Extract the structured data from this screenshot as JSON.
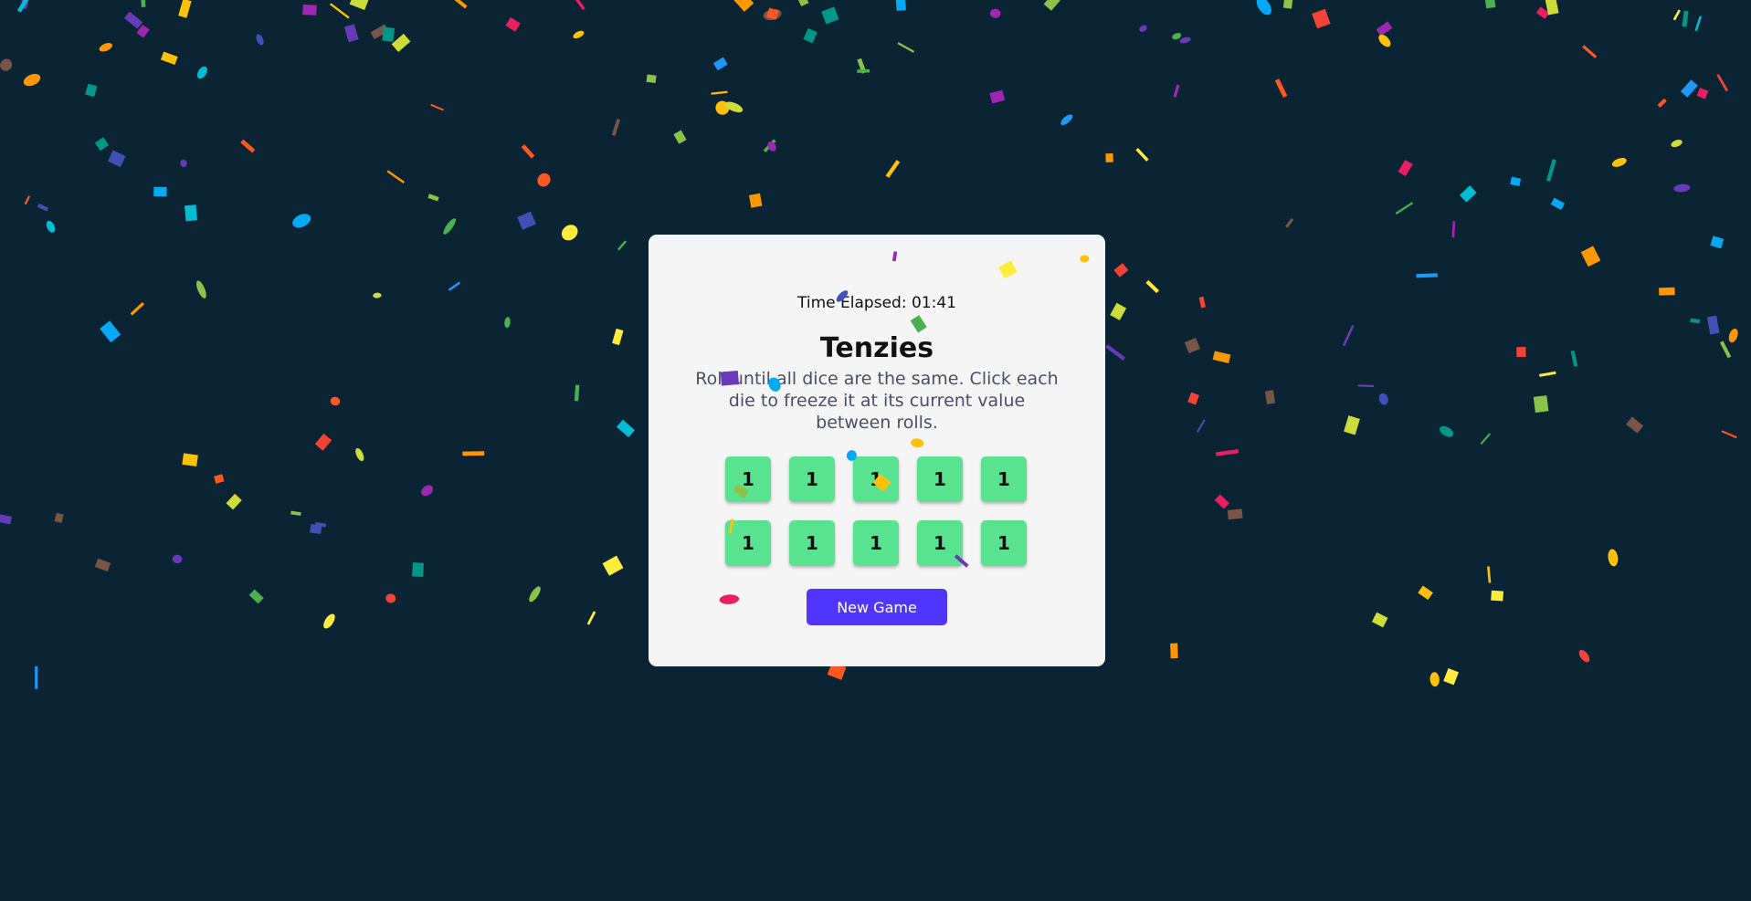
{
  "timer": {
    "label": "Time Elapsed:",
    "value": "01:41"
  },
  "title": "Tenzies",
  "instructions": "Roll until all dice are the same. Click each die to freeze it at its current value between rolls.",
  "dice": [
    "1",
    "1",
    "1",
    "1",
    "1",
    "1",
    "1",
    "1",
    "1",
    "1"
  ],
  "new_game_label": "New Game",
  "colors": {
    "background": "#0b2434",
    "card": "#f5f5f5",
    "die_held": "#59e391",
    "button": "#5035ff"
  },
  "confetti_palette": [
    "#f44336",
    "#e91e63",
    "#9c27b0",
    "#673ab7",
    "#3f51b5",
    "#2196f3",
    "#03a9f4",
    "#00bcd4",
    "#009688",
    "#4caf50",
    "#8bc34a",
    "#cddc39",
    "#ffeb3b",
    "#ffc107",
    "#ff9800",
    "#ff5722",
    "#795548"
  ]
}
